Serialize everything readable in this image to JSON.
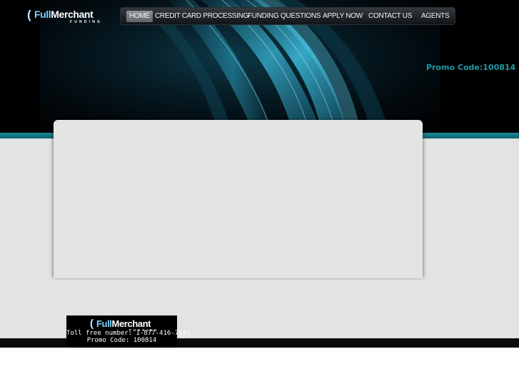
{
  "logo": {
    "brand_part1": "Full",
    "brand_part2": "Merchant",
    "tagline": "FUNDING"
  },
  "nav": {
    "items": [
      {
        "label": "HOME",
        "active": true
      },
      {
        "label": "CREDIT CARD PROCESSING",
        "active": false
      },
      {
        "label": "FUNDING QUESTIONS",
        "active": false
      },
      {
        "label": "APPLY NOW",
        "active": false
      },
      {
        "label": "CONTACT US",
        "active": false
      },
      {
        "label": "AGENTS",
        "active": false
      }
    ]
  },
  "header": {
    "promo_text": "Promo Code:100814"
  },
  "footer": {
    "brand_part1": "Full",
    "brand_part2": "Merchant",
    "tagline": "FUNDING",
    "phone_text": "Toll free number: 1-877-416-7131",
    "promo_text": "Promo Code: 100814"
  },
  "colors": {
    "accent_teal": "#1e9aa6",
    "header_bg": "#000000",
    "content_bg": "#e3e3e3",
    "nav_active_bg": "#7a7f84"
  }
}
